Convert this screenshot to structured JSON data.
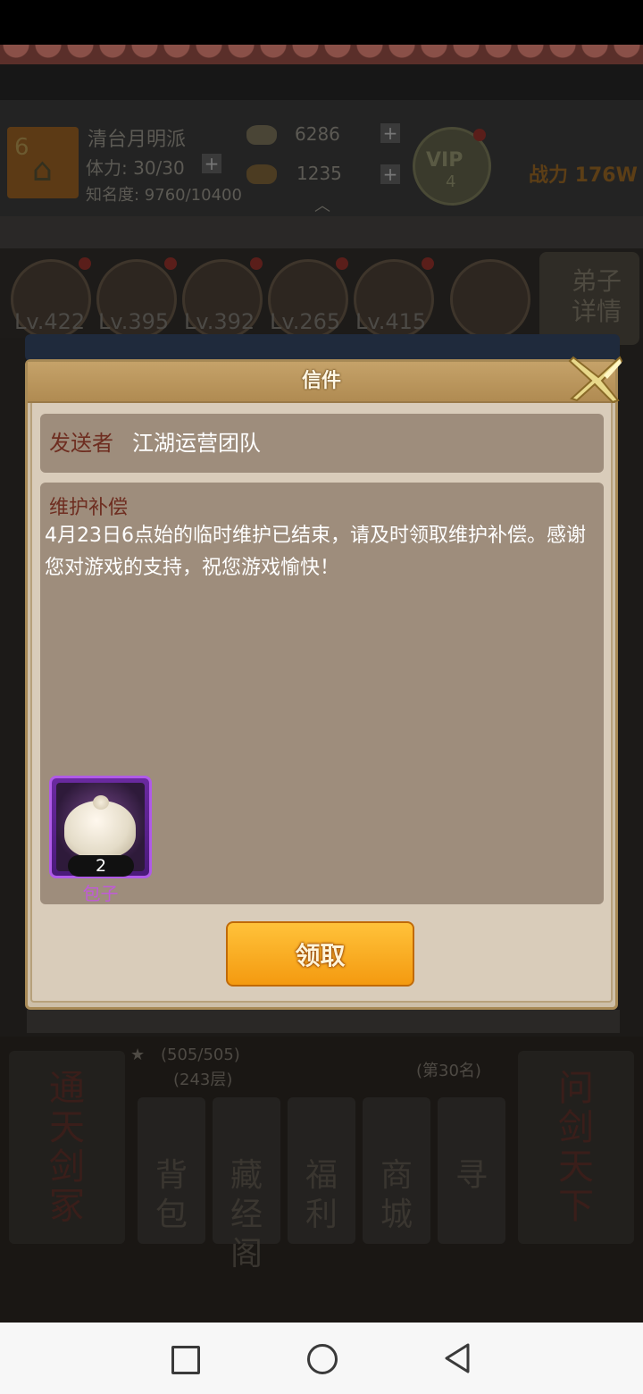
{
  "header": {
    "level": "6",
    "player_name": "清台月明派",
    "stamina": "体力: 30/30",
    "fame": "知名度: 9760/10400",
    "silver": "6286",
    "gold": "1235",
    "vip_label": "VIP",
    "vip_level": "4",
    "power": "战力 176W"
  },
  "disciples": {
    "levels": [
      "Lv.422",
      "Lv.395",
      "Lv.392",
      "Lv.265",
      "Lv.415"
    ],
    "detail_button": "弟子详情"
  },
  "bottom_menu": {
    "left_scroll": "通天剑冢",
    "right_scroll": "问剑天下",
    "tower_progress": "(505/505)",
    "tower_floor": "(243层)",
    "rank": "(第30名)",
    "buttons": [
      "背包",
      "藏经阁",
      "福利",
      "商城",
      "寻"
    ]
  },
  "mail": {
    "title": "信件",
    "sender_label": "发送者",
    "sender_name": "江湖运营团队",
    "subject": "维护补偿",
    "body": "4月23日6点始的临时维护已结束，请及时领取维护补偿。感谢您对游戏的支持，祝您游戏愉快！",
    "attachment": {
      "name": "包子",
      "quantity": "2",
      "icon": "steamed-bun-icon"
    },
    "claim_button": "领取"
  },
  "navbar": {
    "icons": [
      "recent-apps-icon",
      "home-icon",
      "back-icon"
    ]
  },
  "colors": {
    "claim_button": "#f7a61a",
    "dialog_panel": "#9e8d7c",
    "item_frame_purple": "#b05ae8"
  }
}
